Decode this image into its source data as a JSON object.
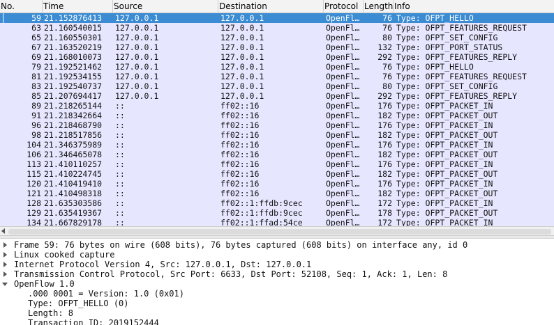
{
  "columns": {
    "no": "No.",
    "time": "Time",
    "source": "Source",
    "destination": "Destination",
    "protocol": "Protocol",
    "length": "Length",
    "info": "Info"
  },
  "packets": [
    {
      "no": "59",
      "time": "21.152876413",
      "source": "127.0.0.1",
      "destination": "127.0.0.1",
      "protocol": "OpenFl…",
      "length": "76",
      "info": "Type: OFPT_HELLO",
      "selected": true
    },
    {
      "no": "63",
      "time": "21.160540015",
      "source": "127.0.0.1",
      "destination": "127.0.0.1",
      "protocol": "OpenFl…",
      "length": "76",
      "info": "Type: OFPT_FEATURES_REQUEST"
    },
    {
      "no": "65",
      "time": "21.160550301",
      "source": "127.0.0.1",
      "destination": "127.0.0.1",
      "protocol": "OpenFl…",
      "length": "80",
      "info": "Type: OFPT_SET_CONFIG"
    },
    {
      "no": "67",
      "time": "21.163520219",
      "source": "127.0.0.1",
      "destination": "127.0.0.1",
      "protocol": "OpenFl…",
      "length": "132",
      "info": "Type: OFPT_PORT_STATUS"
    },
    {
      "no": "69",
      "time": "21.168010073",
      "source": "127.0.0.1",
      "destination": "127.0.0.1",
      "protocol": "OpenFl…",
      "length": "292",
      "info": "Type: OFPT_FEATURES_REPLY"
    },
    {
      "no": "79",
      "time": "21.192521462",
      "source": "127.0.0.1",
      "destination": "127.0.0.1",
      "protocol": "OpenFl…",
      "length": "76",
      "info": "Type: OFPT_HELLO"
    },
    {
      "no": "81",
      "time": "21.192534155",
      "source": "127.0.0.1",
      "destination": "127.0.0.1",
      "protocol": "OpenFl…",
      "length": "76",
      "info": "Type: OFPT_FEATURES_REQUEST"
    },
    {
      "no": "83",
      "time": "21.192540737",
      "source": "127.0.0.1",
      "destination": "127.0.0.1",
      "protocol": "OpenFl…",
      "length": "80",
      "info": "Type: OFPT_SET_CONFIG"
    },
    {
      "no": "85",
      "time": "21.207694417",
      "source": "127.0.0.1",
      "destination": "127.0.0.1",
      "protocol": "OpenFl…",
      "length": "292",
      "info": "Type: OFPT_FEATURES_REPLY"
    },
    {
      "no": "89",
      "time": "21.218265144",
      "source": "::",
      "destination": "ff02::16",
      "protocol": "OpenFl…",
      "length": "176",
      "info": "Type: OFPT_PACKET_IN"
    },
    {
      "no": "91",
      "time": "21.218342664",
      "source": "::",
      "destination": "ff02::16",
      "protocol": "OpenFl…",
      "length": "182",
      "info": "Type: OFPT_PACKET_OUT"
    },
    {
      "no": "96",
      "time": "21.218468790",
      "source": "::",
      "destination": "ff02::16",
      "protocol": "OpenFl…",
      "length": "176",
      "info": "Type: OFPT_PACKET_IN"
    },
    {
      "no": "98",
      "time": "21.218517856",
      "source": "::",
      "destination": "ff02::16",
      "protocol": "OpenFl…",
      "length": "182",
      "info": "Type: OFPT_PACKET_OUT"
    },
    {
      "no": "104",
      "time": "21.346375989",
      "source": "::",
      "destination": "ff02::16",
      "protocol": "OpenFl…",
      "length": "176",
      "info": "Type: OFPT_PACKET_IN"
    },
    {
      "no": "106",
      "time": "21.346465078",
      "source": "::",
      "destination": "ff02::16",
      "protocol": "OpenFl…",
      "length": "182",
      "info": "Type: OFPT_PACKET_OUT"
    },
    {
      "no": "113",
      "time": "21.410110257",
      "source": "::",
      "destination": "ff02::16",
      "protocol": "OpenFl…",
      "length": "176",
      "info": "Type: OFPT_PACKET_IN"
    },
    {
      "no": "115",
      "time": "21.410224745",
      "source": "::",
      "destination": "ff02::16",
      "protocol": "OpenFl…",
      "length": "182",
      "info": "Type: OFPT_PACKET_OUT"
    },
    {
      "no": "120",
      "time": "21.410419410",
      "source": "::",
      "destination": "ff02::16",
      "protocol": "OpenFl…",
      "length": "176",
      "info": "Type: OFPT_PACKET_IN"
    },
    {
      "no": "121",
      "time": "21.410498318",
      "source": "::",
      "destination": "ff02::16",
      "protocol": "OpenFl…",
      "length": "182",
      "info": "Type: OFPT_PACKET_OUT"
    },
    {
      "no": "128",
      "time": "21.635303586",
      "source": "::",
      "destination": "ff02::1:ffdb:9cec",
      "protocol": "OpenFl…",
      "length": "172",
      "info": "Type: OFPT_PACKET_IN"
    },
    {
      "no": "129",
      "time": "21.635419367",
      "source": "::",
      "destination": "ff02::1:ffdb:9cec",
      "protocol": "OpenFl…",
      "length": "178",
      "info": "Type: OFPT_PACKET_OUT"
    },
    {
      "no": "134",
      "time": "21.667829178",
      "source": "::",
      "destination": "ff02::1:ffad:54ce",
      "protocol": "OpenFl…",
      "length": "172",
      "info": "Type: OFPT_PACKET_IN"
    }
  ],
  "details": {
    "frame": "Frame 59: 76 bytes on wire (608 bits), 76 bytes captured (608 bits) on interface any, id 0",
    "linux_cooked": "Linux cooked capture",
    "ip": "Internet Protocol Version 4, Src: 127.0.0.1, Dst: 127.0.0.1",
    "tcp": "Transmission Control Protocol, Src Port: 6633, Dst Port: 52108, Seq: 1, Ack: 1, Len: 8",
    "openflow": "OpenFlow 1.0",
    "of_version": ".000 0001 = Version: 1.0 (0x01)",
    "of_type": "Type: OFPT_HELLO (0)",
    "of_length": "Length: 8",
    "of_xid": "Transaction ID: 2019152444"
  },
  "colors": {
    "row_background": "#e7e6ff",
    "selected_background": "#3b8cd2"
  }
}
